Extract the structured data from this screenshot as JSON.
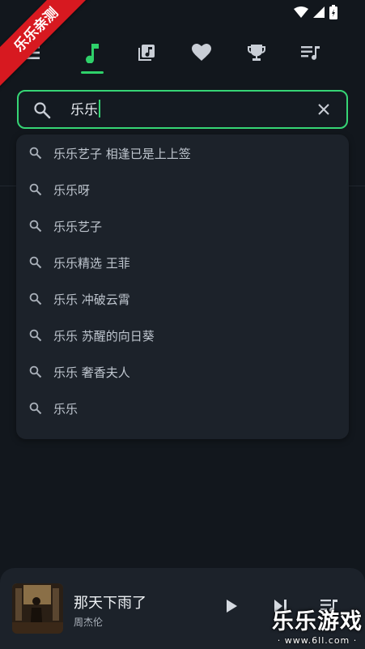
{
  "watermark": {
    "ribbon": "乐乐亲测",
    "site_name": "乐乐游戏",
    "site_url": "· www.6ll.com ·"
  },
  "nav": {
    "tabs": [
      {
        "icon": "menu-icon"
      },
      {
        "icon": "music-note-icon",
        "active": true
      },
      {
        "icon": "library-icon"
      },
      {
        "icon": "heart-icon"
      },
      {
        "icon": "trophy-icon"
      },
      {
        "icon": "playlist-icon"
      }
    ],
    "accent": "#2fd16a"
  },
  "search": {
    "value": "乐乐",
    "accent": "#36d575"
  },
  "suggestions": [
    "乐乐艺子 相逢已是上上签",
    "乐乐呀",
    "乐乐艺子",
    "乐乐精选 王菲",
    "乐乐 冲破云霄",
    "乐乐 苏醒的向日葵",
    "乐乐 奢香夫人",
    "乐乐"
  ],
  "player": {
    "title": "那天下雨了",
    "artist": "周杰伦"
  }
}
